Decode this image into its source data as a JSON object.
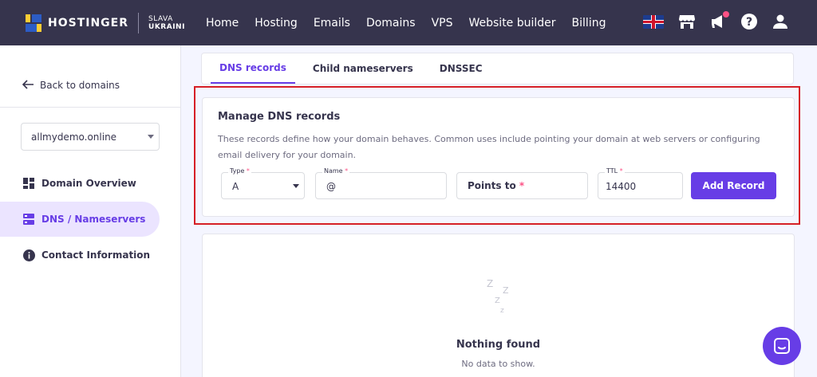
{
  "brand": {
    "name": "HOSTINGER",
    "slogan_top": "SLAVA",
    "slogan_bottom": "UKRAINI"
  },
  "nav": [
    "Home",
    "Hosting",
    "Emails",
    "Domains",
    "VPS",
    "Website builder",
    "Billing"
  ],
  "top_icons": [
    "uk-flag-icon",
    "store-icon",
    "megaphone-icon",
    "help-icon",
    "user-icon"
  ],
  "sidebar": {
    "back": "Back to domains",
    "domain": "allmydemo.online",
    "items": [
      {
        "label": "Domain Overview",
        "icon": "dashboard-icon"
      },
      {
        "label": "DNS / Nameservers",
        "icon": "server-icon",
        "active": true
      },
      {
        "label": "Contact Information",
        "icon": "info-icon"
      }
    ]
  },
  "tabs": [
    "DNS records",
    "Child nameservers",
    "DNSSEC"
  ],
  "manage": {
    "title": "Manage DNS records",
    "description": "These records define how your domain behaves. Common uses include pointing your domain at web servers or configuring email delivery for your domain.",
    "type_label": "Type",
    "type_value": "A",
    "name_label": "Name",
    "name_value": "@",
    "points_placeholder": "Points to",
    "ttl_label": "TTL",
    "ttl_value": "14400",
    "add_button": "Add Record"
  },
  "empty": {
    "title": "Nothing found",
    "subtitle": "No data to show.",
    "zzz": "Z z z"
  },
  "colors": {
    "accent": "#673de6",
    "topbar": "#36344d",
    "highlight": "#d61f26"
  }
}
